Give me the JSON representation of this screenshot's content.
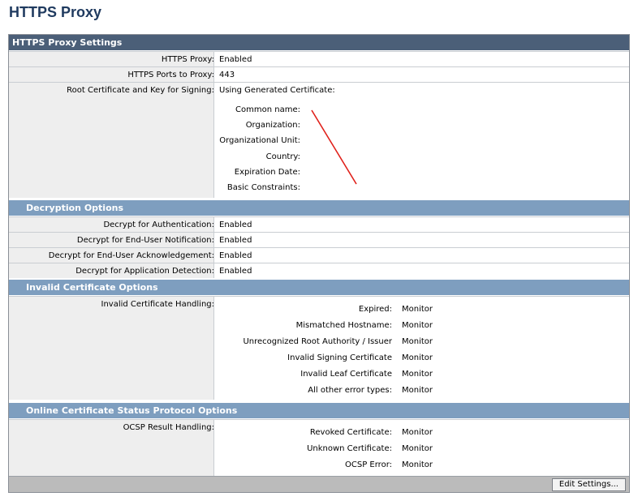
{
  "page": {
    "title": "HTTPS Proxy"
  },
  "settings": {
    "header": "HTTPS Proxy Settings",
    "https_proxy": {
      "label": "HTTPS Proxy:",
      "value": "Enabled"
    },
    "ports": {
      "label": "HTTPS Ports to Proxy:",
      "value": "443"
    },
    "root_cert": {
      "label": "Root Certificate and Key for Signing:",
      "value": "Using Generated Certificate:",
      "fields": [
        {
          "label": "Common name:",
          "value": ""
        },
        {
          "label": "Organization:",
          "value": ""
        },
        {
          "label": "Organizational Unit:",
          "value": ""
        },
        {
          "label": "Country:",
          "value": ""
        },
        {
          "label": "Expiration Date:",
          "value": ""
        },
        {
          "label": "Basic Constraints:",
          "value": ""
        }
      ]
    }
  },
  "decryption": {
    "header": "Decryption Options",
    "rows": [
      {
        "label": "Decrypt for Authentication:",
        "value": "Enabled"
      },
      {
        "label": "Decrypt for End-User Notification:",
        "value": "Enabled"
      },
      {
        "label": "Decrypt for End-User Acknowledgement:",
        "value": "Enabled"
      },
      {
        "label": "Decrypt for Application Detection:",
        "value": "Enabled"
      }
    ]
  },
  "invalid_cert": {
    "header": "Invalid Certificate Options",
    "label": "Invalid Certificate Handling:",
    "items": [
      {
        "label": "Expired:",
        "value": "Monitor"
      },
      {
        "label": "Mismatched Hostname:",
        "value": "Monitor"
      },
      {
        "label": "Unrecognized Root Authority / Issuer",
        "value": "Monitor"
      },
      {
        "label": "Invalid Signing Certificate",
        "value": "Monitor"
      },
      {
        "label": "Invalid Leaf Certificate",
        "value": "Monitor"
      },
      {
        "label": "All other error types:",
        "value": "Monitor"
      }
    ]
  },
  "ocsp": {
    "header": "Online Certificate Status Protocol Options",
    "label": "OCSP Result Handling:",
    "items": [
      {
        "label": "Revoked Certificate:",
        "value": "Monitor"
      },
      {
        "label": "Unknown Certificate:",
        "value": "Monitor"
      },
      {
        "label": "OCSP Error:",
        "value": "Monitor"
      }
    ]
  },
  "footer": {
    "edit_button": "Edit Settings..."
  },
  "colors": {
    "title": "#1f3a5f",
    "header_dark": "#4b5f78",
    "header_light": "#7e9ebf",
    "annotation_line": "#e0201a"
  }
}
